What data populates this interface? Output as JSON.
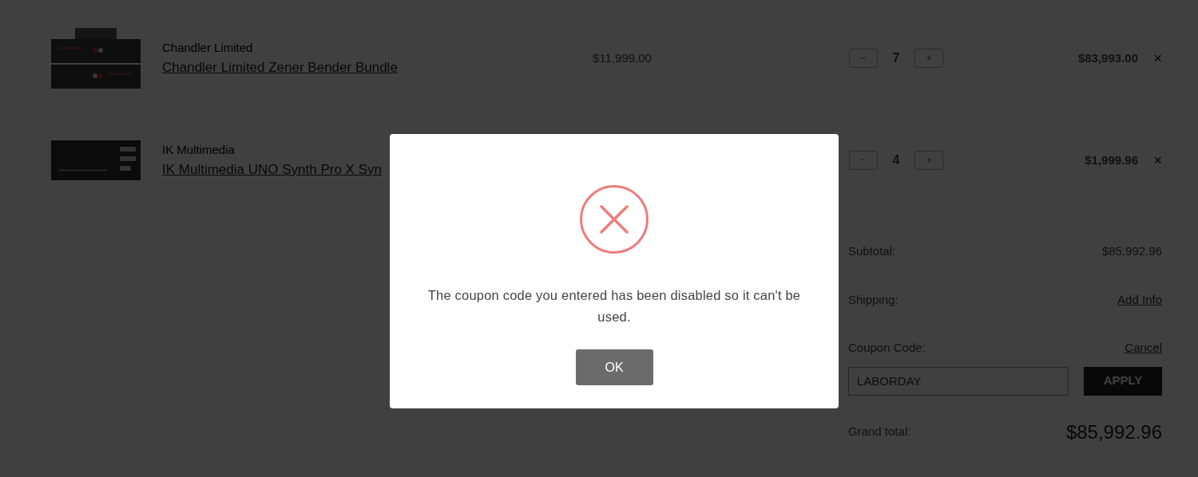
{
  "cart_items": [
    {
      "brand": "Chandler Limited",
      "name": "Chandler Limited Zener Bender Bundle",
      "price": "$11,999.00",
      "minus": "−",
      "quantity": "7",
      "plus": "+",
      "total": "$83,993.00",
      "remove": "×"
    },
    {
      "brand": "IK Multimedia",
      "name": "IK Multimedia UNO Synth Pro X Syn",
      "minus": "−",
      "quantity": "4",
      "plus": "+",
      "total": "$1,999.96",
      "remove": "×"
    }
  ],
  "summary": {
    "subtotal_label": "Subtotal:",
    "subtotal": "$85,992.96",
    "shipping_label": "Shipping:",
    "shipping_link": "Add Info",
    "coupon_label": "Coupon Code:",
    "coupon_link": "Cancel",
    "coupon_value": "LABORDAY",
    "apply": "APPLY",
    "grand_total_label": "Grand total:",
    "grand_total": "$85,992.96"
  },
  "dialog": {
    "message": "The coupon code you entered has been disabled so it can't be used.",
    "button": "OK"
  }
}
